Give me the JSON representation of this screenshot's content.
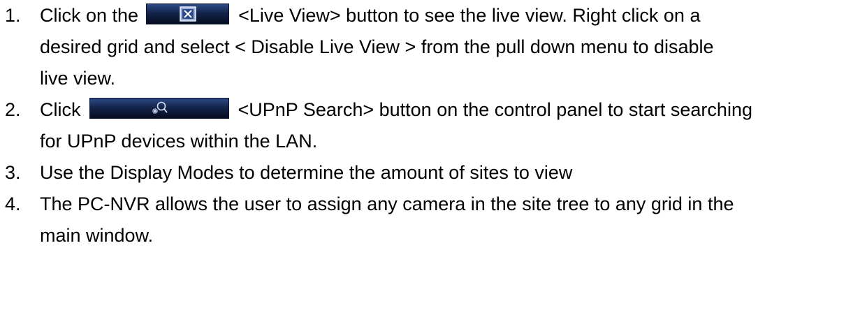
{
  "instructions": [
    {
      "number": "1.",
      "lines": [
        {
          "before": "Click on the",
          "button": {
            "label": "Live View",
            "icon": "live-view-icon"
          },
          "after": "<Live View> button to see the live view.   Right click on a"
        },
        {
          "text": "desired grid and select < Disable Live View > from the pull down menu to disable"
        },
        {
          "text": "live view."
        }
      ]
    },
    {
      "number": "2.",
      "lines": [
        {
          "before": "Click",
          "button": {
            "label": "UPnP Search",
            "icon": "upnp-search-icon"
          },
          "after": "<UPnP Search> button on the control panel to start searching"
        },
        {
          "text": "for UPnP devices within the LAN."
        }
      ]
    },
    {
      "number": "3.",
      "lines": [
        {
          "text": "Use the Display Modes to determine the amount of sites to view"
        }
      ]
    },
    {
      "number": "4.",
      "lines": [
        {
          "text": "The PC-NVR allows the user to assign any camera in the site tree to any grid in the"
        },
        {
          "text": "main window."
        }
      ]
    }
  ],
  "colors": {
    "text": "#000000",
    "background": "#ffffff",
    "button_gradient_top": "#2e4a86",
    "button_gradient_bottom": "#060d1f"
  }
}
